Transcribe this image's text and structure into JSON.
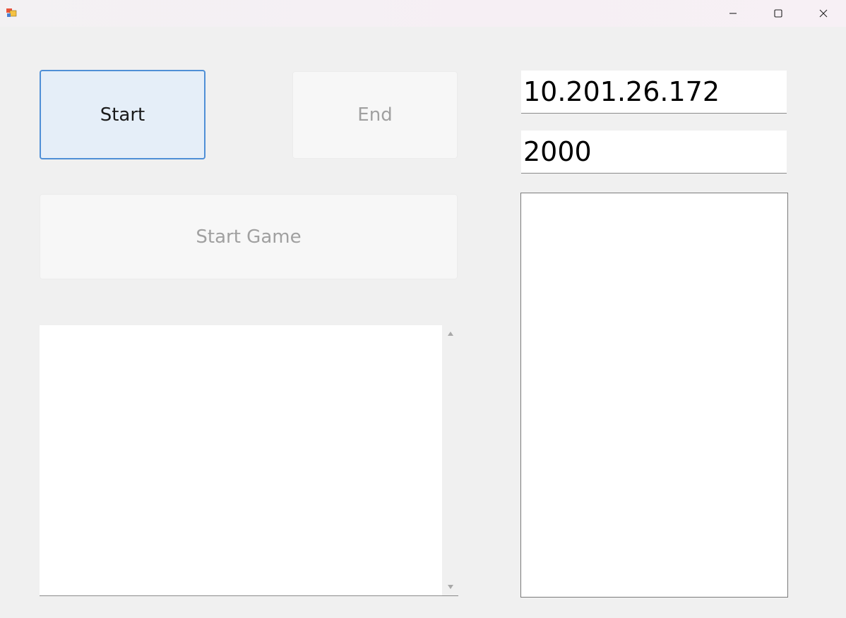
{
  "window": {
    "controls": [
      "minimize-icon",
      "maximize-icon",
      "close-icon"
    ]
  },
  "buttons": {
    "start_label": "Start",
    "end_label": "End",
    "start_game_label": "Start Game"
  },
  "fields": {
    "ip_value": "10.201.26.172",
    "port_value": "2000"
  },
  "log": {
    "text": ""
  },
  "list": {
    "items": []
  },
  "colors": {
    "accent": "#4f8fd6",
    "start_bg": "#e5eef8",
    "disabled_text": "#a0a0a0"
  }
}
